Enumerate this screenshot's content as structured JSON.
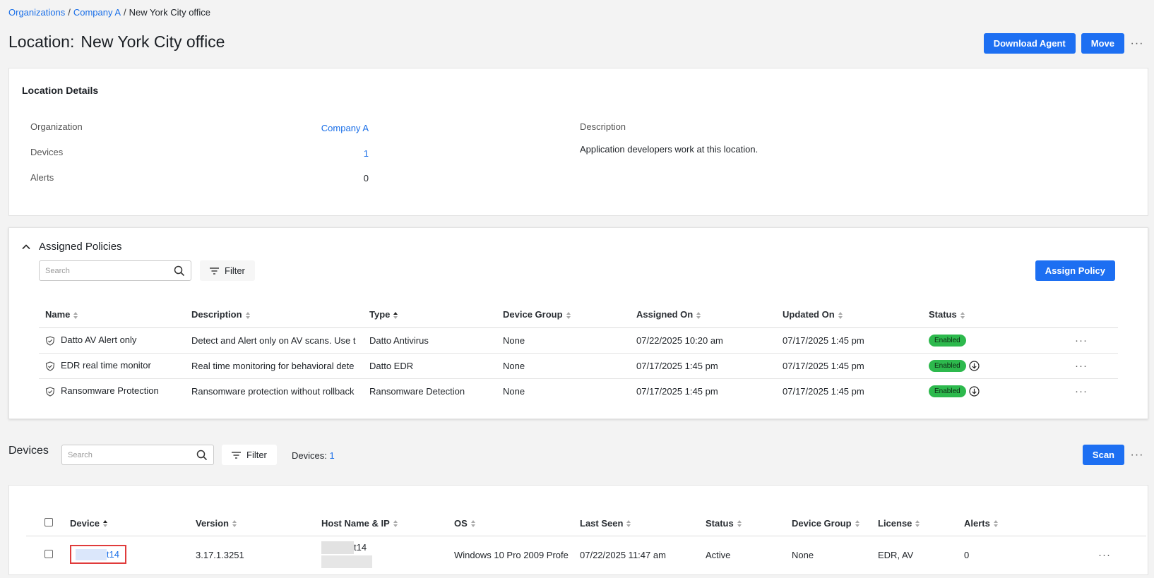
{
  "breadcrumb": {
    "items": [
      "Organizations",
      "Company A"
    ],
    "current": "New York City office"
  },
  "page": {
    "title_prefix": "Location:",
    "title_name": "New York City office",
    "download_agent_label": "Download Agent",
    "move_label": "Move"
  },
  "location_details": {
    "title": "Location Details",
    "organization_label": "Organization",
    "organization_value": "Company A",
    "devices_label": "Devices",
    "devices_value": "1",
    "alerts_label": "Alerts",
    "alerts_value": "0",
    "description_label": "Description",
    "description_value": "Application developers work at this location."
  },
  "policies": {
    "title": "Assigned Policies",
    "search_placeholder": "Search",
    "filter_label": "Filter",
    "assign_label": "Assign Policy",
    "columns": [
      "Name",
      "Description",
      "Type",
      "Device Group",
      "Assigned On",
      "Updated On",
      "Status"
    ],
    "rows": [
      {
        "name": "Datto AV Alert only",
        "description": "Detect and Alert only on AV scans. Use t",
        "type": "Datto Antivirus",
        "group": "None",
        "assigned": "07/22/2025 10:20 am",
        "updated": "07/17/2025 1:45 pm",
        "status": "Enabled",
        "download": false
      },
      {
        "name": "EDR real time monitor",
        "description": "Real time monitoring for behavioral dete",
        "type": "Datto EDR",
        "group": "None",
        "assigned": "07/17/2025 1:45 pm",
        "updated": "07/17/2025 1:45 pm",
        "status": "Enabled",
        "download": true
      },
      {
        "name": "Ransomware Protection",
        "description": "Ransomware protection without rollback",
        "type": "Ransomware Detection",
        "group": "None",
        "assigned": "07/17/2025 1:45 pm",
        "updated": "07/17/2025 1:45 pm",
        "status": "Enabled",
        "download": true
      }
    ]
  },
  "devices": {
    "title": "Devices",
    "search_placeholder": "Search",
    "filter_label": "Filter",
    "count_label": "Devices:",
    "count_value": "1",
    "scan_label": "Scan",
    "columns": [
      "Device",
      "Version",
      "Host Name & IP",
      "OS",
      "Last Seen",
      "Status",
      "Device Group",
      "License",
      "Alerts"
    ],
    "rows": [
      {
        "device": "t14",
        "version": "3.17.1.3251",
        "host": "t14",
        "os": "Windows 10 Pro 2009 Profe",
        "last_seen": "07/22/2025 11:47 am",
        "status": "Active",
        "group": "None",
        "license": "EDR, AV",
        "alerts": "0"
      }
    ]
  },
  "colors": {
    "primary": "#1d6ff2",
    "link": "#1a6fe8",
    "enabled_badge": "#2db94d",
    "highlight_border": "#e03b3b"
  }
}
